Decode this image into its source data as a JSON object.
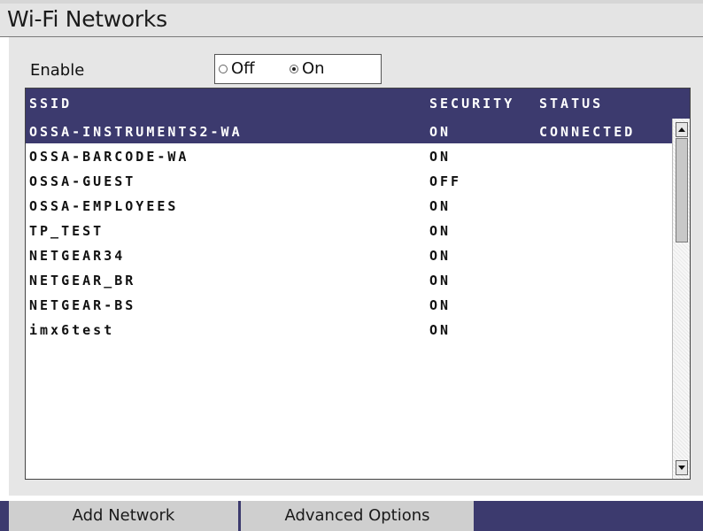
{
  "window": {
    "title": "Wi-Fi Networks"
  },
  "enable": {
    "label": "Enable",
    "options": [
      {
        "label": "Off",
        "selected": false
      },
      {
        "label": "On",
        "selected": true
      }
    ]
  },
  "table": {
    "headers": {
      "ssid": "SSID",
      "security": "SECURITY",
      "status": "STATUS"
    },
    "rows": [
      {
        "ssid": "OSSA-INSTRUMENTS2-WA",
        "security": "ON",
        "status": "CONNECTED",
        "selected": true
      },
      {
        "ssid": "OSSA-BARCODE-WA",
        "security": "ON",
        "status": ""
      },
      {
        "ssid": "OSSA-GUEST",
        "security": "OFF",
        "status": ""
      },
      {
        "ssid": "OSSA-EMPLOYEES",
        "security": "ON",
        "status": ""
      },
      {
        "ssid": "TP_TEST",
        "security": "ON",
        "status": ""
      },
      {
        "ssid": "NETGEAR34",
        "security": "ON",
        "status": ""
      },
      {
        "ssid": "NETGEAR_BR",
        "security": "ON",
        "status": ""
      },
      {
        "ssid": "NETGEAR-BS",
        "security": "ON",
        "status": ""
      },
      {
        "ssid": "imx6test",
        "security": "ON",
        "status": ""
      }
    ]
  },
  "softkeys": {
    "add_network": "Add Network",
    "advanced_options": "Advanced Options"
  },
  "colors": {
    "accent": "#3c3a6e",
    "panel": "#e6e6e6",
    "softkey": "#cfcfcf"
  },
  "icons": {
    "scroll_up": "triangle-up",
    "scroll_down": "triangle-down",
    "radio": "radio-button"
  }
}
